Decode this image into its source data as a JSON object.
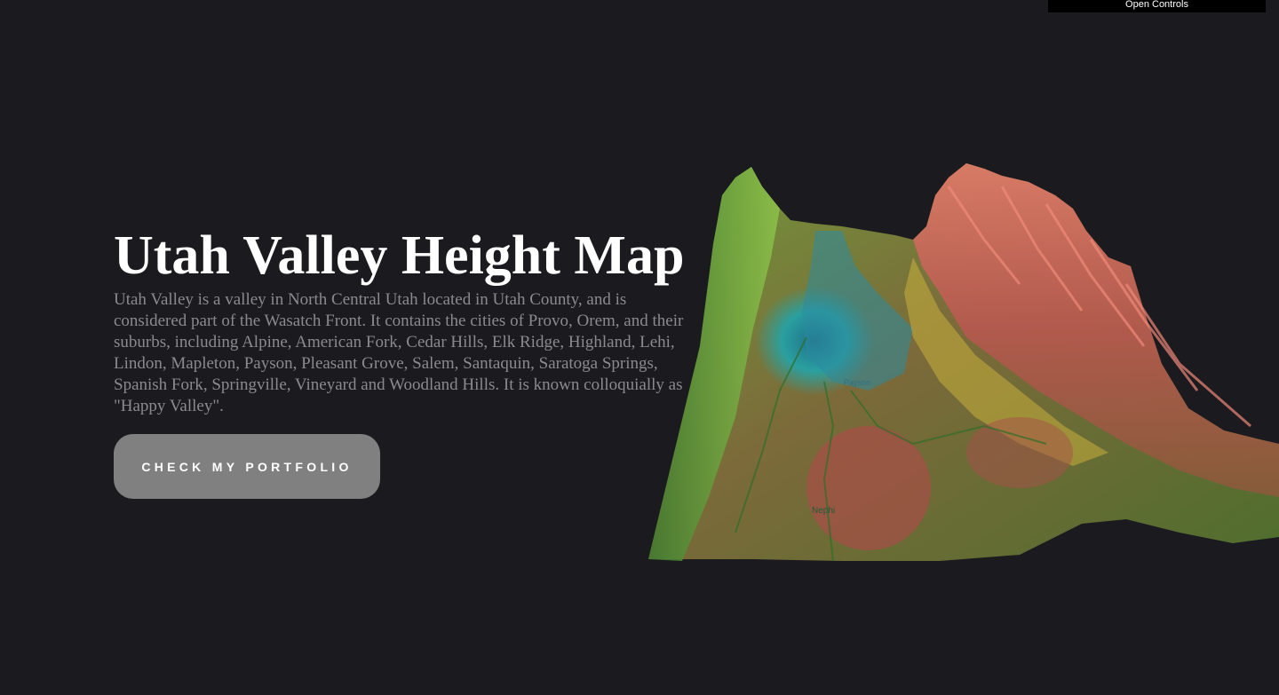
{
  "controls": {
    "label": "Open Controls"
  },
  "hero": {
    "title": "Utah Valley Height Map",
    "description": "Utah Valley is a valley in North Central Utah located in Utah County, and is considered part of the Wasatch Front. It contains the cities of Provo, Orem, and their suburbs, including Alpine, American Fork, Cedar Hills, Elk Ridge, Highland, Lehi, Lindon, Mapleton, Payson, Pleasant Grove, Salem, Santaquin, Saratoga Springs, Spanish Fork, Springville, Vineyard and Woodland Hills. It is known colloquially as \"Happy Valley\".",
    "cta_label": "CHECK MY PORTFOLIO"
  },
  "map": {
    "labels": [
      "Payson",
      "Nephi"
    ]
  },
  "colors": {
    "background": "#1b1a1f",
    "title": "#ffffff",
    "description": "#8b8a90",
    "button": "#808080",
    "controls_bar": "#000000"
  }
}
